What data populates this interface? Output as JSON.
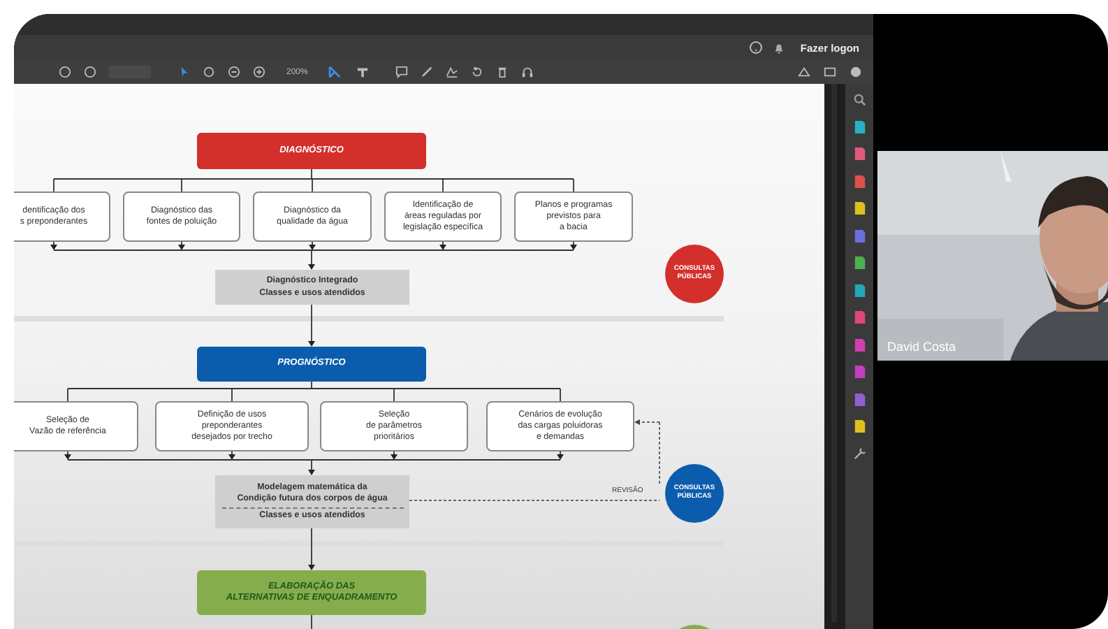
{
  "account": {
    "sign_in": "Fazer logon"
  },
  "toolbar": {
    "zoom": "200%"
  },
  "diagram": {
    "stages": [
      {
        "title": "DIAGNÓSTICO",
        "color": "#d3302b",
        "steps": [
          "dentificação dos\ns preponderantes",
          "Diagnóstico das\nfontes de poluição",
          "Diagnóstico da\nqualidade da água",
          "Identificação de\náreas reguladas por\nlegislação específica",
          "Planos e programas\nprevistos para\na bacia"
        ],
        "result": [
          "Diagnóstico Integrado\nClasses e usos atendidos"
        ],
        "badge": {
          "text": "CONSULTAS\nPÚBLICAS",
          "color": "#d3302b"
        }
      },
      {
        "title": "PROGNÓSTICO",
        "color": "#0b5cad",
        "steps": [
          "Seleção de\nVazão de referência",
          "Definição de usos\npreponderantes\ndesejados por trecho",
          "Seleção\nde parâmetros\nprioritários",
          "Cenários de evolução\ndas cargas poluidoras\ne demandas"
        ],
        "result": [
          "Modelagem matemática da\nCondição futura dos corpos de água",
          "Classes e usos atendidos"
        ],
        "revision": "REVISÃO",
        "badge": {
          "text": "CONSULTAS\nPÚBLICAS",
          "color": "#0b5cad"
        }
      },
      {
        "title": "ELABORAÇÃO DAS\nALTERNATIVAS DE ENQUADRAMENTO",
        "color": "#86ad4c",
        "badge": {
          "color": "#86ad4c"
        }
      }
    ]
  },
  "tools": [
    {
      "color": "#2ab0c8"
    },
    {
      "color": "#e05a7a"
    },
    {
      "color": "#e0504a"
    },
    {
      "color": "#d8c020"
    },
    {
      "color": "#6a70e0"
    },
    {
      "color": "#4cb050"
    },
    {
      "color": "#20a8b8"
    },
    {
      "color": "#e04878"
    },
    {
      "color": "#d040b0"
    },
    {
      "color": "#c040c0"
    },
    {
      "color": "#9060d0"
    },
    {
      "color": "#e0c020"
    }
  ],
  "video": {
    "name": "David Costa"
  }
}
